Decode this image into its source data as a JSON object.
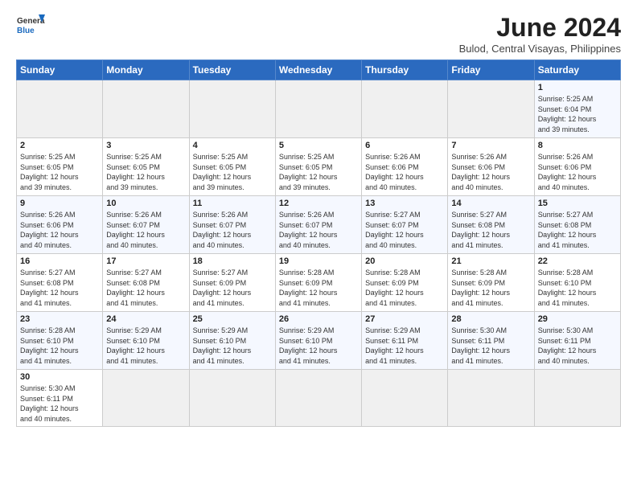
{
  "header": {
    "logo_line1": "General",
    "logo_line2": "Blue",
    "title": "June 2024",
    "subtitle": "Bulod, Central Visayas, Philippines"
  },
  "days_of_week": [
    "Sunday",
    "Monday",
    "Tuesday",
    "Wednesday",
    "Thursday",
    "Friday",
    "Saturday"
  ],
  "weeks": [
    [
      {
        "day": "",
        "info": ""
      },
      {
        "day": "",
        "info": ""
      },
      {
        "day": "",
        "info": ""
      },
      {
        "day": "",
        "info": ""
      },
      {
        "day": "",
        "info": ""
      },
      {
        "day": "",
        "info": ""
      },
      {
        "day": "1",
        "info": "Sunrise: 5:25 AM\nSunset: 6:04 PM\nDaylight: 12 hours\nand 39 minutes."
      }
    ],
    [
      {
        "day": "2",
        "info": "Sunrise: 5:25 AM\nSunset: 6:05 PM\nDaylight: 12 hours\nand 39 minutes."
      },
      {
        "day": "3",
        "info": "Sunrise: 5:25 AM\nSunset: 6:05 PM\nDaylight: 12 hours\nand 39 minutes."
      },
      {
        "day": "4",
        "info": "Sunrise: 5:25 AM\nSunset: 6:05 PM\nDaylight: 12 hours\nand 39 minutes."
      },
      {
        "day": "5",
        "info": "Sunrise: 5:25 AM\nSunset: 6:05 PM\nDaylight: 12 hours\nand 39 minutes."
      },
      {
        "day": "6",
        "info": "Sunrise: 5:26 AM\nSunset: 6:06 PM\nDaylight: 12 hours\nand 40 minutes."
      },
      {
        "day": "7",
        "info": "Sunrise: 5:26 AM\nSunset: 6:06 PM\nDaylight: 12 hours\nand 40 minutes."
      },
      {
        "day": "8",
        "info": "Sunrise: 5:26 AM\nSunset: 6:06 PM\nDaylight: 12 hours\nand 40 minutes."
      }
    ],
    [
      {
        "day": "9",
        "info": "Sunrise: 5:26 AM\nSunset: 6:06 PM\nDaylight: 12 hours\nand 40 minutes."
      },
      {
        "day": "10",
        "info": "Sunrise: 5:26 AM\nSunset: 6:07 PM\nDaylight: 12 hours\nand 40 minutes."
      },
      {
        "day": "11",
        "info": "Sunrise: 5:26 AM\nSunset: 6:07 PM\nDaylight: 12 hours\nand 40 minutes."
      },
      {
        "day": "12",
        "info": "Sunrise: 5:26 AM\nSunset: 6:07 PM\nDaylight: 12 hours\nand 40 minutes."
      },
      {
        "day": "13",
        "info": "Sunrise: 5:27 AM\nSunset: 6:07 PM\nDaylight: 12 hours\nand 40 minutes."
      },
      {
        "day": "14",
        "info": "Sunrise: 5:27 AM\nSunset: 6:08 PM\nDaylight: 12 hours\nand 41 minutes."
      },
      {
        "day": "15",
        "info": "Sunrise: 5:27 AM\nSunset: 6:08 PM\nDaylight: 12 hours\nand 41 minutes."
      }
    ],
    [
      {
        "day": "16",
        "info": "Sunrise: 5:27 AM\nSunset: 6:08 PM\nDaylight: 12 hours\nand 41 minutes."
      },
      {
        "day": "17",
        "info": "Sunrise: 5:27 AM\nSunset: 6:08 PM\nDaylight: 12 hours\nand 41 minutes."
      },
      {
        "day": "18",
        "info": "Sunrise: 5:27 AM\nSunset: 6:09 PM\nDaylight: 12 hours\nand 41 minutes."
      },
      {
        "day": "19",
        "info": "Sunrise: 5:28 AM\nSunset: 6:09 PM\nDaylight: 12 hours\nand 41 minutes."
      },
      {
        "day": "20",
        "info": "Sunrise: 5:28 AM\nSunset: 6:09 PM\nDaylight: 12 hours\nand 41 minutes."
      },
      {
        "day": "21",
        "info": "Sunrise: 5:28 AM\nSunset: 6:09 PM\nDaylight: 12 hours\nand 41 minutes."
      },
      {
        "day": "22",
        "info": "Sunrise: 5:28 AM\nSunset: 6:10 PM\nDaylight: 12 hours\nand 41 minutes."
      }
    ],
    [
      {
        "day": "23",
        "info": "Sunrise: 5:28 AM\nSunset: 6:10 PM\nDaylight: 12 hours\nand 41 minutes."
      },
      {
        "day": "24",
        "info": "Sunrise: 5:29 AM\nSunset: 6:10 PM\nDaylight: 12 hours\nand 41 minutes."
      },
      {
        "day": "25",
        "info": "Sunrise: 5:29 AM\nSunset: 6:10 PM\nDaylight: 12 hours\nand 41 minutes."
      },
      {
        "day": "26",
        "info": "Sunrise: 5:29 AM\nSunset: 6:10 PM\nDaylight: 12 hours\nand 41 minutes."
      },
      {
        "day": "27",
        "info": "Sunrise: 5:29 AM\nSunset: 6:11 PM\nDaylight: 12 hours\nand 41 minutes."
      },
      {
        "day": "28",
        "info": "Sunrise: 5:30 AM\nSunset: 6:11 PM\nDaylight: 12 hours\nand 41 minutes."
      },
      {
        "day": "29",
        "info": "Sunrise: 5:30 AM\nSunset: 6:11 PM\nDaylight: 12 hours\nand 40 minutes."
      }
    ],
    [
      {
        "day": "30",
        "info": "Sunrise: 5:30 AM\nSunset: 6:11 PM\nDaylight: 12 hours\nand 40 minutes."
      },
      {
        "day": "",
        "info": ""
      },
      {
        "day": "",
        "info": ""
      },
      {
        "day": "",
        "info": ""
      },
      {
        "day": "",
        "info": ""
      },
      {
        "day": "",
        "info": ""
      },
      {
        "day": "",
        "info": ""
      }
    ]
  ]
}
